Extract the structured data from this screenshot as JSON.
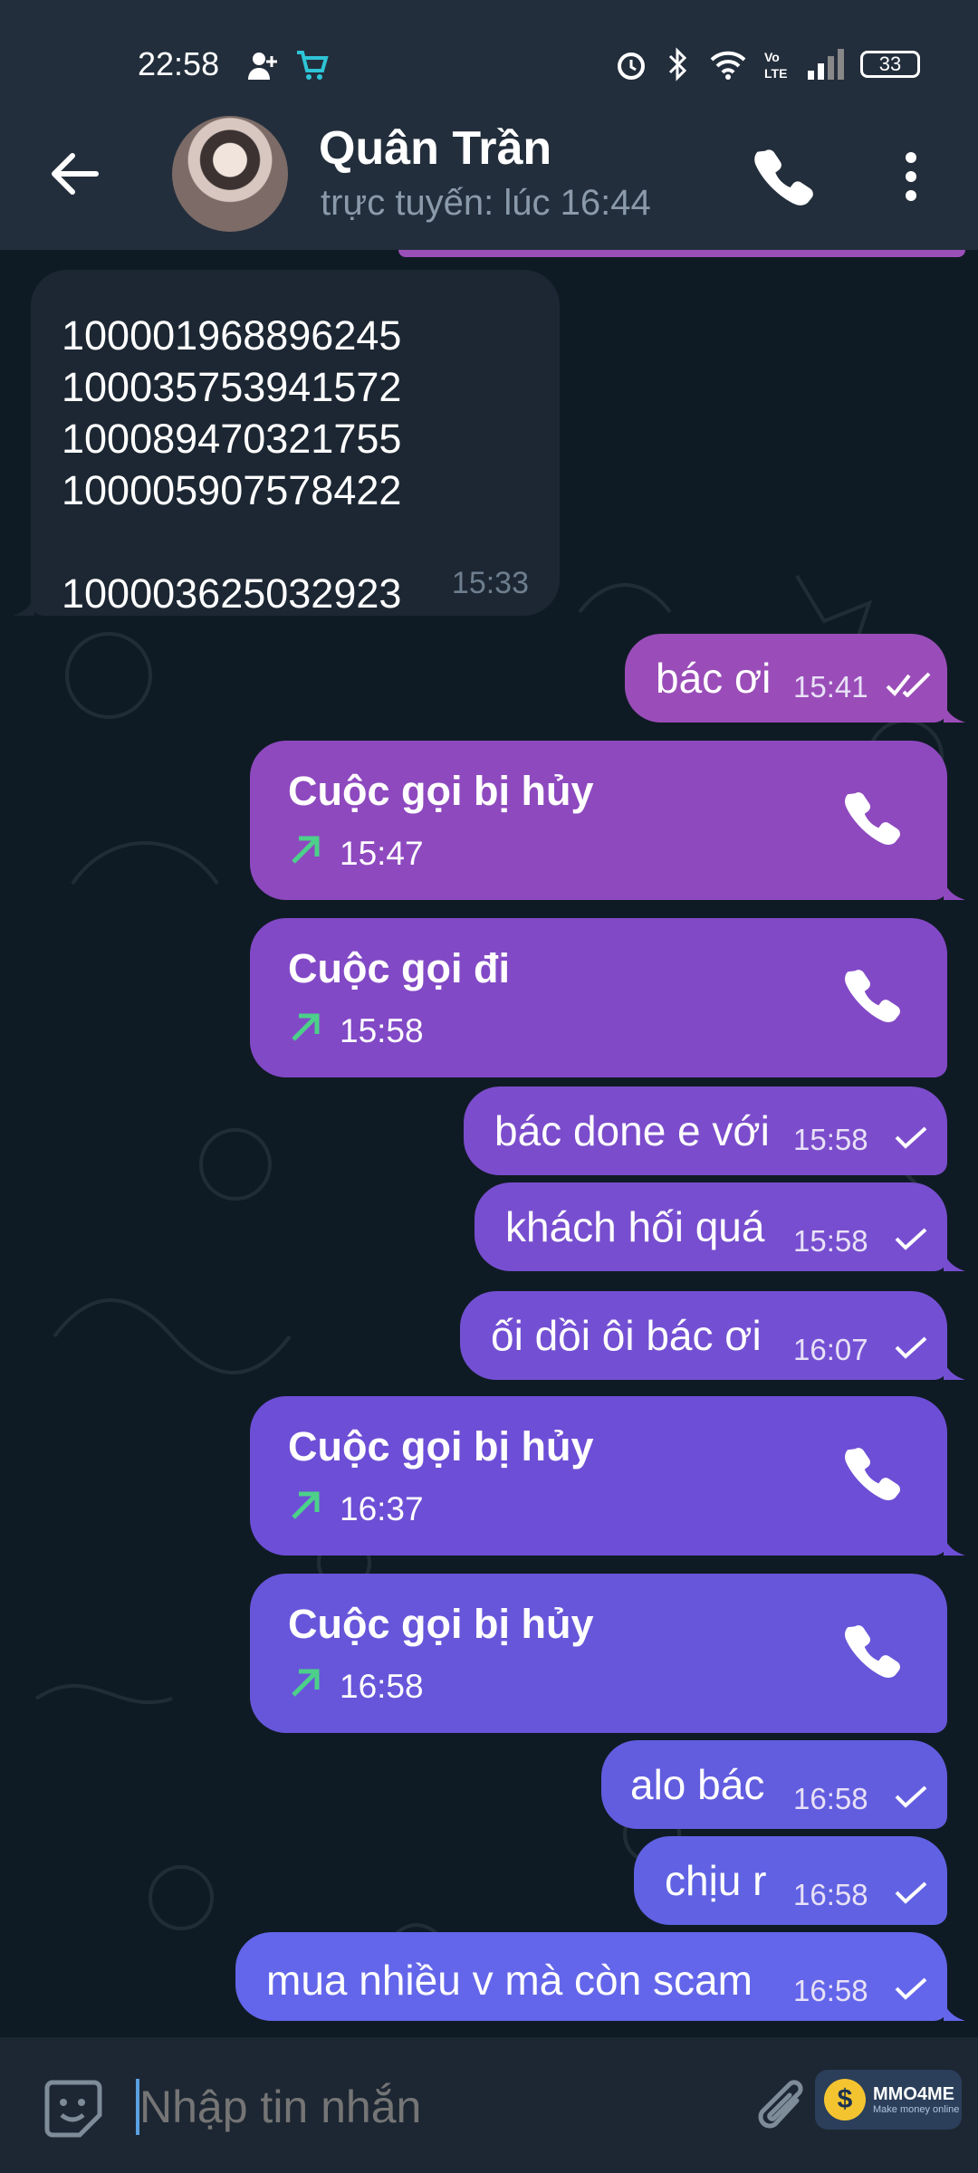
{
  "status_bar": {
    "time": "22:58",
    "battery": "33",
    "icons": [
      "add-user-icon",
      "cart-icon",
      "alarm-icon",
      "bluetooth-icon",
      "wifi-icon",
      "volte-icon",
      "signal-icon",
      "battery-icon"
    ]
  },
  "header": {
    "contact_name": "Quân Trần",
    "contact_status": "trực tuyến: lúc 16:44",
    "icons": [
      "back-arrow-icon",
      "phone-icon",
      "more-vertical-icon"
    ]
  },
  "messages": {
    "incoming": {
      "text": "100001968896245\n100035753941572\n100089470321755\n100005907578422\n\n100003625032923",
      "time": "15:33"
    },
    "out1": {
      "text": "bác ơi",
      "time": "15:41",
      "status": "read"
    },
    "call1": {
      "title": "Cuộc gọi bị hủy",
      "time": "15:47"
    },
    "call2": {
      "title": "Cuộc gọi đi",
      "time": "15:58"
    },
    "out2": {
      "text": "bác done e với",
      "time": "15:58",
      "status": "sent"
    },
    "out3": {
      "text": "khách hối quá",
      "time": "15:58",
      "status": "sent"
    },
    "out4": {
      "text": "ối dồi ôi bác ơi",
      "time": "16:07",
      "status": "sent"
    },
    "call3": {
      "title": "Cuộc gọi bị hủy",
      "time": "16:37"
    },
    "call4": {
      "title": "Cuộc gọi bị hủy",
      "time": "16:58"
    },
    "out5": {
      "text": "alo bác",
      "time": "16:58",
      "status": "sent"
    },
    "out6": {
      "text": "chịu r",
      "time": "16:58",
      "status": "sent"
    },
    "out7": {
      "text": "mua nhiều v mà còn scam",
      "time": "16:58",
      "status": "sent"
    }
  },
  "composer": {
    "placeholder": "Nhập tin nhắn",
    "watermark_title": "MMO4ME",
    "watermark_sub": "Make money online"
  },
  "colors": {
    "header_bg": "#232e3c",
    "chat_bg": "#0f1b24",
    "incoming_bubble": "#1c2733",
    "outgoing_gradient": [
      "#9a4db8",
      "#8148c8",
      "#6a52dc",
      "#6365ea"
    ],
    "call_arrow": "#4cd08a"
  }
}
